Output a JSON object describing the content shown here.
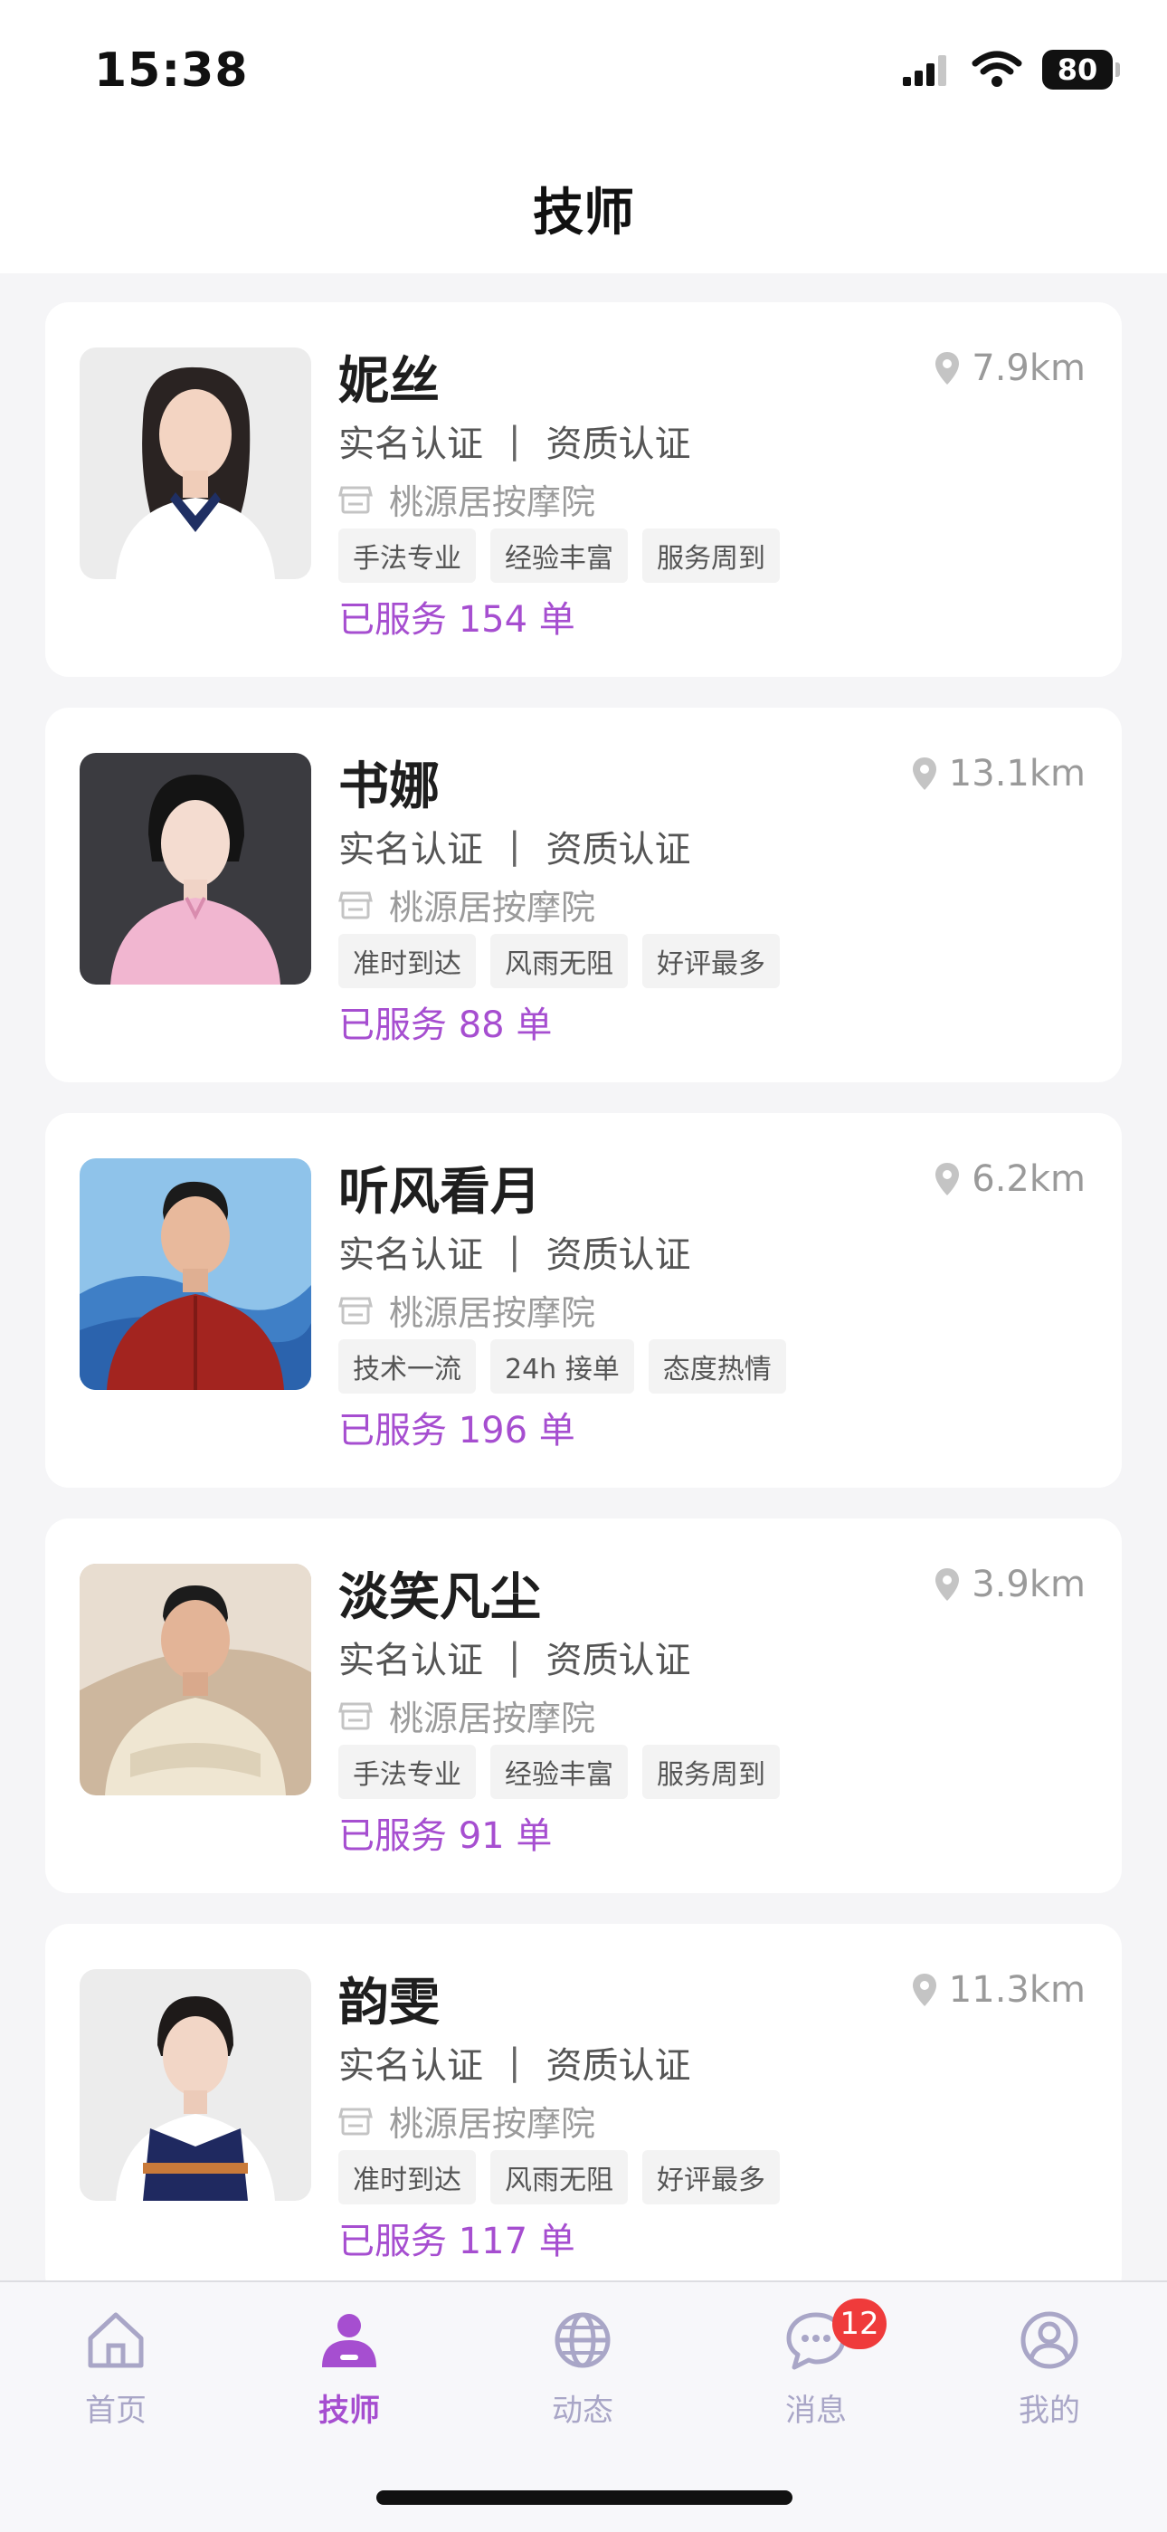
{
  "status_bar": {
    "time": "15:38",
    "battery": "80"
  },
  "nav": {
    "title": "技师"
  },
  "list": {
    "cards": [
      {
        "name": "妮丝",
        "distance": "7.9km",
        "cert_real": "实名认证",
        "cert_sep": "|",
        "cert_qual": "资质认证",
        "shop": "桃源居按摩院",
        "tags": [
          "手法专业",
          "经验丰富",
          "服务周到"
        ],
        "served": "已服务 154 单"
      },
      {
        "name": "书娜",
        "distance": "13.1km",
        "cert_real": "实名认证",
        "cert_sep": "|",
        "cert_qual": "资质认证",
        "shop": "桃源居按摩院",
        "tags": [
          "准时到达",
          "风雨无阻",
          "好评最多"
        ],
        "served": "已服务 88 单"
      },
      {
        "name": "听风看月",
        "distance": "6.2km",
        "cert_real": "实名认证",
        "cert_sep": "|",
        "cert_qual": "资质认证",
        "shop": "桃源居按摩院",
        "tags": [
          "技术一流",
          "24h 接单",
          "态度热情"
        ],
        "served": "已服务 196 单"
      },
      {
        "name": "淡笑凡尘",
        "distance": "3.9km",
        "cert_real": "实名认证",
        "cert_sep": "|",
        "cert_qual": "资质认证",
        "shop": "桃源居按摩院",
        "tags": [
          "手法专业",
          "经验丰富",
          "服务周到"
        ],
        "served": "已服务 91 单"
      },
      {
        "name": "韵雯",
        "distance": "11.3km",
        "cert_real": "实名认证",
        "cert_sep": "|",
        "cert_qual": "资质认证",
        "shop": "桃源居按摩院",
        "tags": [
          "准时到达",
          "风雨无阻",
          "好评最多"
        ],
        "served": "已服务 117 单"
      }
    ]
  },
  "tabs": [
    {
      "label": "首页",
      "icon": "home-icon",
      "active": false
    },
    {
      "label": "技师",
      "icon": "technician-icon",
      "active": true
    },
    {
      "label": "动态",
      "icon": "globe-icon",
      "active": false
    },
    {
      "label": "消息",
      "icon": "chat-icon",
      "active": false,
      "badge": "12"
    },
    {
      "label": "我的",
      "icon": "profile-icon",
      "active": false
    }
  ],
  "colors": {
    "accent": "#a64ed0",
    "tab_inactive": "#a9a6c7",
    "badge": "#ef3b3b"
  }
}
